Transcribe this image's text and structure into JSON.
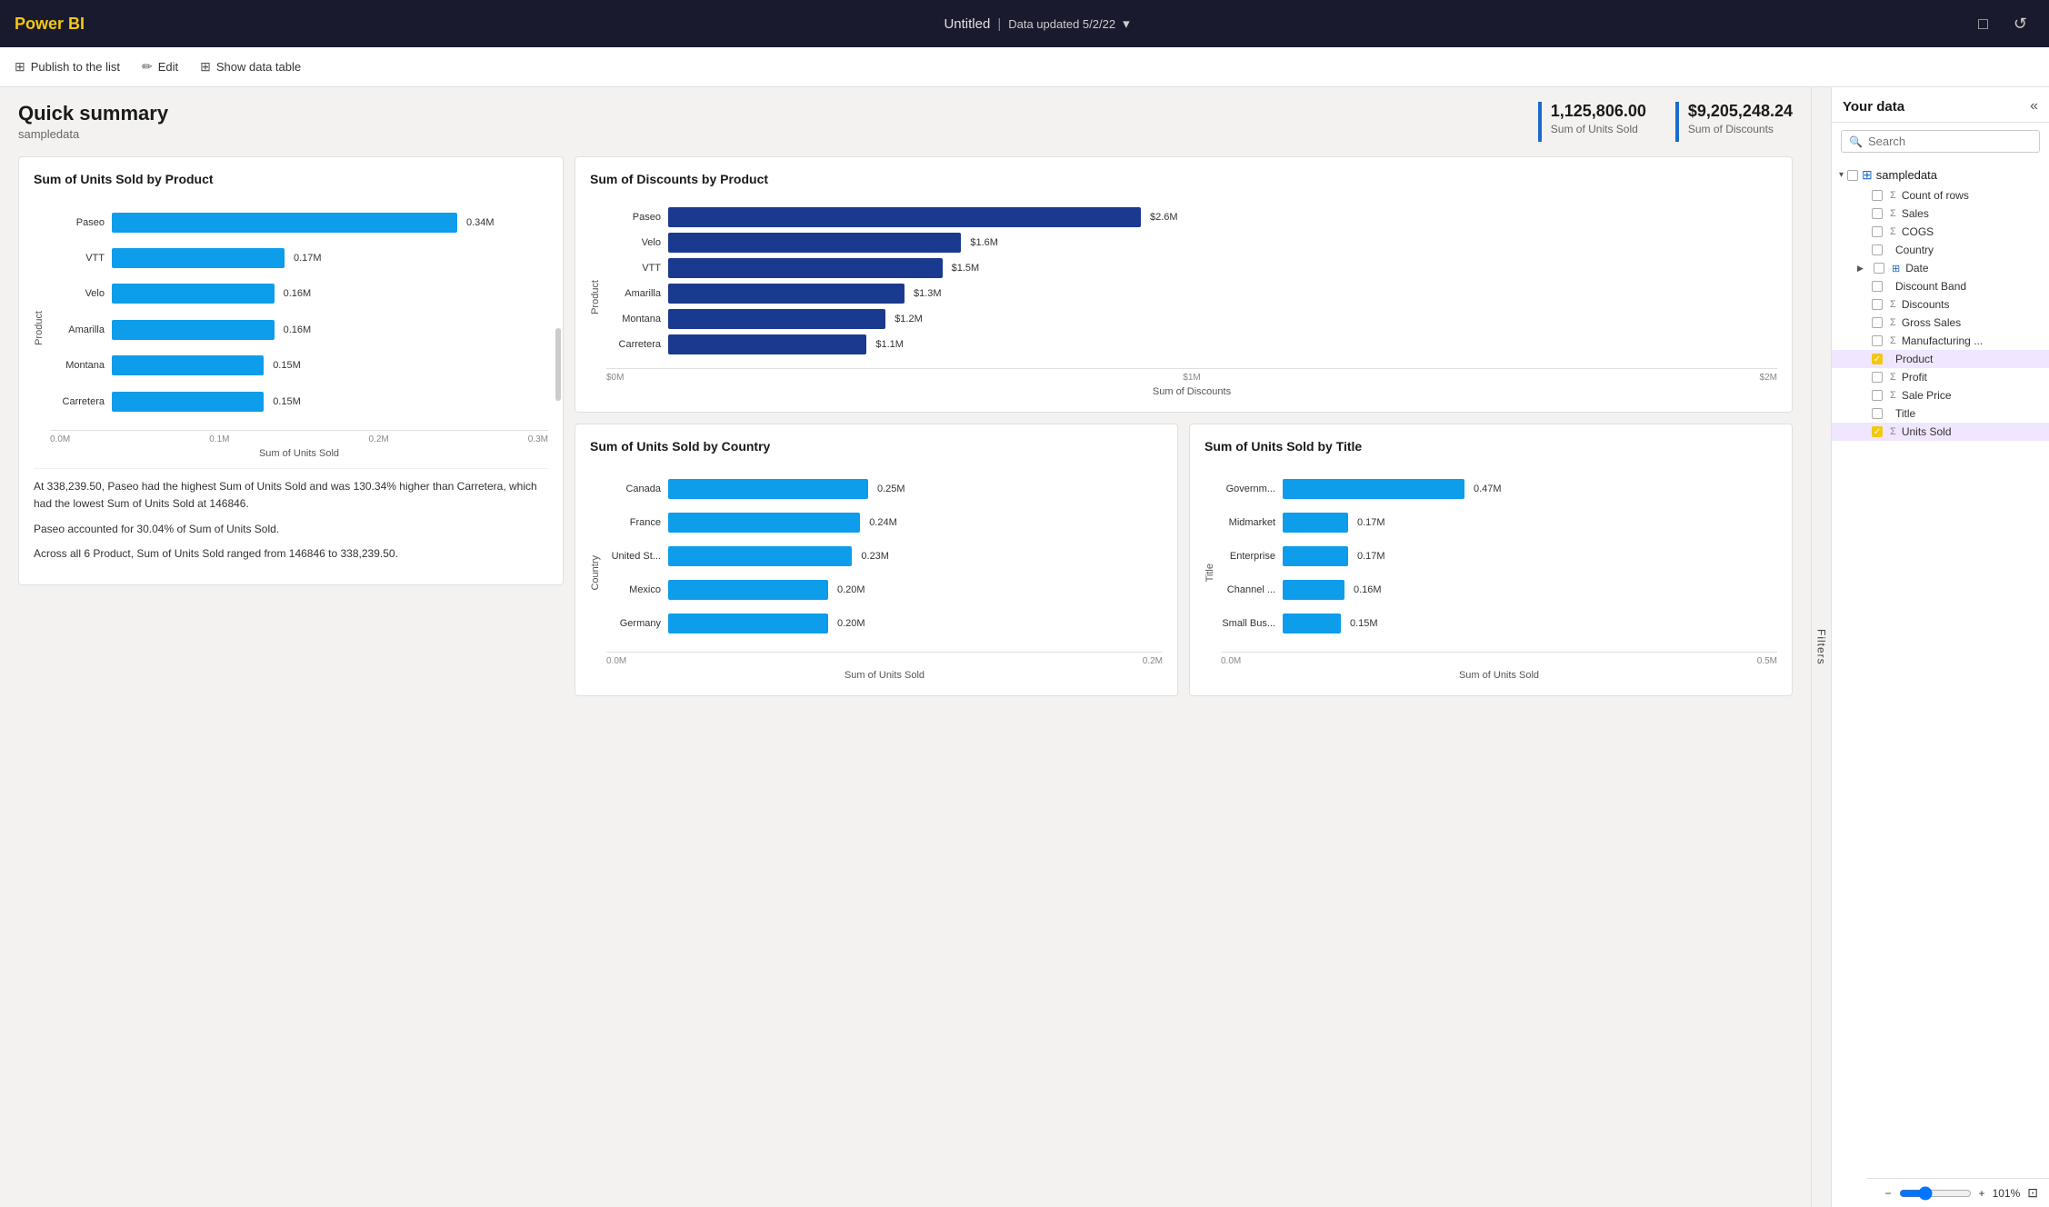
{
  "topbar": {
    "logo": "Power BI",
    "title": "Untitled",
    "subtitle": "Data updated 5/2/22",
    "chevron": "▾",
    "icons": [
      "□",
      "↺"
    ]
  },
  "toolbar": {
    "publish_icon": "⊞",
    "publish_label": "Publish to the list",
    "edit_icon": "✏",
    "edit_label": "Edit",
    "table_icon": "⊞",
    "table_label": "Show data table"
  },
  "summary": {
    "title": "Quick summary",
    "subtitle": "sampledata",
    "kpis": [
      {
        "value": "1,125,806.00",
        "label": "Sum of Units Sold"
      },
      {
        "value": "$9,205,248.24",
        "label": "Sum of Discounts"
      }
    ]
  },
  "chart1": {
    "title": "Sum of Units Sold by Product",
    "x_label": "Sum of Units Sold",
    "y_label": "Product",
    "bars": [
      {
        "label": "Paseo",
        "value": "0.34M",
        "pct": 100
      },
      {
        "label": "VTT",
        "value": "0.17M",
        "pct": 50
      },
      {
        "label": "Velo",
        "value": "0.16M",
        "pct": 47
      },
      {
        "label": "Amarilla",
        "value": "0.16M",
        "pct": 47
      },
      {
        "label": "Montana",
        "value": "0.15M",
        "pct": 44
      },
      {
        "label": "Carretera",
        "value": "0.15M",
        "pct": 44
      }
    ],
    "x_ticks": [
      "0.0M",
      "0.1M",
      "0.2M",
      "0.3M"
    ],
    "color": "#0d9dea",
    "insight": [
      "At 338,239.50, Paseo had the highest Sum of Units Sold and was 130.34% higher than Carretera, which had the lowest Sum of Units Sold at 146846.",
      "Paseo accounted for 30.04% of Sum of Units Sold.",
      "Across all 6 Product, Sum of Units Sold ranged from 146846 to 338,239.50."
    ]
  },
  "chart2": {
    "title": "Sum of Discounts by Product",
    "x_label": "Sum of Discounts",
    "y_label": "Product",
    "bars": [
      {
        "label": "Paseo",
        "value": "$2.6M",
        "pct": 100
      },
      {
        "label": "Velo",
        "value": "$1.6M",
        "pct": 62
      },
      {
        "label": "VTT",
        "value": "$1.5M",
        "pct": 58
      },
      {
        "label": "Amarilla",
        "value": "$1.3M",
        "pct": 50
      },
      {
        "label": "Montana",
        "value": "$1.2M",
        "pct": 46
      },
      {
        "label": "Carretera",
        "value": "$1.1M",
        "pct": 42
      }
    ],
    "x_ticks": [
      "$0M",
      "$1M",
      "$2M"
    ],
    "color": "#1a3a8f"
  },
  "chart3": {
    "title": "Sum of Units Sold by Country",
    "x_label": "Sum of Units Sold",
    "y_label": "Country",
    "bars": [
      {
        "label": "Canada",
        "value": "0.25M",
        "pct": 100
      },
      {
        "label": "France",
        "value": "0.24M",
        "pct": 96
      },
      {
        "label": "United St...",
        "value": "0.23M",
        "pct": 92
      },
      {
        "label": "Mexico",
        "value": "0.20M",
        "pct": 80
      },
      {
        "label": "Germany",
        "value": "0.20M",
        "pct": 80
      }
    ],
    "x_ticks": [
      "0.0M",
      "0.2M"
    ],
    "color": "#0d9dea"
  },
  "chart4": {
    "title": "Sum of Units Sold by Title",
    "x_label": "Sum of Units Sold",
    "y_label": "Title",
    "bars": [
      {
        "label": "Governm...",
        "value": "0.47M",
        "pct": 100
      },
      {
        "label": "Midmarket",
        "value": "0.17M",
        "pct": 36
      },
      {
        "label": "Enterprise",
        "value": "0.17M",
        "pct": 36
      },
      {
        "label": "Channel ...",
        "value": "0.16M",
        "pct": 34
      },
      {
        "label": "Small Bus...",
        "value": "0.15M",
        "pct": 32
      }
    ],
    "x_ticks": [
      "0.0M",
      "0.5M"
    ],
    "color": "#0d9dea"
  },
  "filters": {
    "label": "Filters"
  },
  "data_panel": {
    "title": "Your data",
    "search_placeholder": "Search",
    "group": "sampledata",
    "items": [
      {
        "name": "Count of rows",
        "type": "sigma",
        "checked": false,
        "active": false
      },
      {
        "name": "Sales",
        "type": "sigma",
        "checked": false,
        "active": false
      },
      {
        "name": "COGS",
        "type": "sigma",
        "checked": false,
        "active": false
      },
      {
        "name": "Country",
        "type": "field",
        "checked": false,
        "active": false
      },
      {
        "name": "Date",
        "type": "date",
        "checked": false,
        "active": false,
        "expandable": true
      },
      {
        "name": "Discount Band",
        "type": "field",
        "checked": false,
        "active": false
      },
      {
        "name": "Discounts",
        "type": "sigma",
        "checked": false,
        "active": false
      },
      {
        "name": "Gross Sales",
        "type": "sigma",
        "checked": false,
        "active": false
      },
      {
        "name": "Manufacturing ...",
        "type": "sigma",
        "checked": false,
        "active": false
      },
      {
        "name": "Product",
        "type": "field",
        "checked": true,
        "active": true
      },
      {
        "name": "Profit",
        "type": "sigma",
        "checked": false,
        "active": false
      },
      {
        "name": "Sale Price",
        "type": "sigma",
        "checked": false,
        "active": false
      },
      {
        "name": "Title",
        "type": "field",
        "checked": false,
        "active": false
      },
      {
        "name": "Units Sold",
        "type": "sigma",
        "checked": true,
        "active": true
      }
    ]
  },
  "zoom": {
    "level": "101%"
  }
}
